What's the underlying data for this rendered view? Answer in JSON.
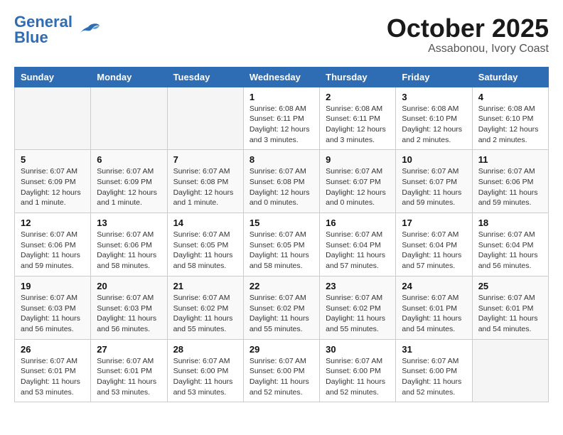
{
  "header": {
    "logo_line1": "General",
    "logo_line2": "Blue",
    "month": "October 2025",
    "location": "Assabonou, Ivory Coast"
  },
  "weekdays": [
    "Sunday",
    "Monday",
    "Tuesday",
    "Wednesday",
    "Thursday",
    "Friday",
    "Saturday"
  ],
  "weeks": [
    [
      {
        "day": "",
        "info": ""
      },
      {
        "day": "",
        "info": ""
      },
      {
        "day": "",
        "info": ""
      },
      {
        "day": "1",
        "info": "Sunrise: 6:08 AM\nSunset: 6:11 PM\nDaylight: 12 hours and 3 minutes."
      },
      {
        "day": "2",
        "info": "Sunrise: 6:08 AM\nSunset: 6:11 PM\nDaylight: 12 hours and 3 minutes."
      },
      {
        "day": "3",
        "info": "Sunrise: 6:08 AM\nSunset: 6:10 PM\nDaylight: 12 hours and 2 minutes."
      },
      {
        "day": "4",
        "info": "Sunrise: 6:08 AM\nSunset: 6:10 PM\nDaylight: 12 hours and 2 minutes."
      }
    ],
    [
      {
        "day": "5",
        "info": "Sunrise: 6:07 AM\nSunset: 6:09 PM\nDaylight: 12 hours and 1 minute."
      },
      {
        "day": "6",
        "info": "Sunrise: 6:07 AM\nSunset: 6:09 PM\nDaylight: 12 hours and 1 minute."
      },
      {
        "day": "7",
        "info": "Sunrise: 6:07 AM\nSunset: 6:08 PM\nDaylight: 12 hours and 1 minute."
      },
      {
        "day": "8",
        "info": "Sunrise: 6:07 AM\nSunset: 6:08 PM\nDaylight: 12 hours and 0 minutes."
      },
      {
        "day": "9",
        "info": "Sunrise: 6:07 AM\nSunset: 6:07 PM\nDaylight: 12 hours and 0 minutes."
      },
      {
        "day": "10",
        "info": "Sunrise: 6:07 AM\nSunset: 6:07 PM\nDaylight: 11 hours and 59 minutes."
      },
      {
        "day": "11",
        "info": "Sunrise: 6:07 AM\nSunset: 6:06 PM\nDaylight: 11 hours and 59 minutes."
      }
    ],
    [
      {
        "day": "12",
        "info": "Sunrise: 6:07 AM\nSunset: 6:06 PM\nDaylight: 11 hours and 59 minutes."
      },
      {
        "day": "13",
        "info": "Sunrise: 6:07 AM\nSunset: 6:06 PM\nDaylight: 11 hours and 58 minutes."
      },
      {
        "day": "14",
        "info": "Sunrise: 6:07 AM\nSunset: 6:05 PM\nDaylight: 11 hours and 58 minutes."
      },
      {
        "day": "15",
        "info": "Sunrise: 6:07 AM\nSunset: 6:05 PM\nDaylight: 11 hours and 58 minutes."
      },
      {
        "day": "16",
        "info": "Sunrise: 6:07 AM\nSunset: 6:04 PM\nDaylight: 11 hours and 57 minutes."
      },
      {
        "day": "17",
        "info": "Sunrise: 6:07 AM\nSunset: 6:04 PM\nDaylight: 11 hours and 57 minutes."
      },
      {
        "day": "18",
        "info": "Sunrise: 6:07 AM\nSunset: 6:04 PM\nDaylight: 11 hours and 56 minutes."
      }
    ],
    [
      {
        "day": "19",
        "info": "Sunrise: 6:07 AM\nSunset: 6:03 PM\nDaylight: 11 hours and 56 minutes."
      },
      {
        "day": "20",
        "info": "Sunrise: 6:07 AM\nSunset: 6:03 PM\nDaylight: 11 hours and 56 minutes."
      },
      {
        "day": "21",
        "info": "Sunrise: 6:07 AM\nSunset: 6:02 PM\nDaylight: 11 hours and 55 minutes."
      },
      {
        "day": "22",
        "info": "Sunrise: 6:07 AM\nSunset: 6:02 PM\nDaylight: 11 hours and 55 minutes."
      },
      {
        "day": "23",
        "info": "Sunrise: 6:07 AM\nSunset: 6:02 PM\nDaylight: 11 hours and 55 minutes."
      },
      {
        "day": "24",
        "info": "Sunrise: 6:07 AM\nSunset: 6:01 PM\nDaylight: 11 hours and 54 minutes."
      },
      {
        "day": "25",
        "info": "Sunrise: 6:07 AM\nSunset: 6:01 PM\nDaylight: 11 hours and 54 minutes."
      }
    ],
    [
      {
        "day": "26",
        "info": "Sunrise: 6:07 AM\nSunset: 6:01 PM\nDaylight: 11 hours and 53 minutes."
      },
      {
        "day": "27",
        "info": "Sunrise: 6:07 AM\nSunset: 6:01 PM\nDaylight: 11 hours and 53 minutes."
      },
      {
        "day": "28",
        "info": "Sunrise: 6:07 AM\nSunset: 6:00 PM\nDaylight: 11 hours and 53 minutes."
      },
      {
        "day": "29",
        "info": "Sunrise: 6:07 AM\nSunset: 6:00 PM\nDaylight: 11 hours and 52 minutes."
      },
      {
        "day": "30",
        "info": "Sunrise: 6:07 AM\nSunset: 6:00 PM\nDaylight: 11 hours and 52 minutes."
      },
      {
        "day": "31",
        "info": "Sunrise: 6:07 AM\nSunset: 6:00 PM\nDaylight: 11 hours and 52 minutes."
      },
      {
        "day": "",
        "info": ""
      }
    ]
  ]
}
